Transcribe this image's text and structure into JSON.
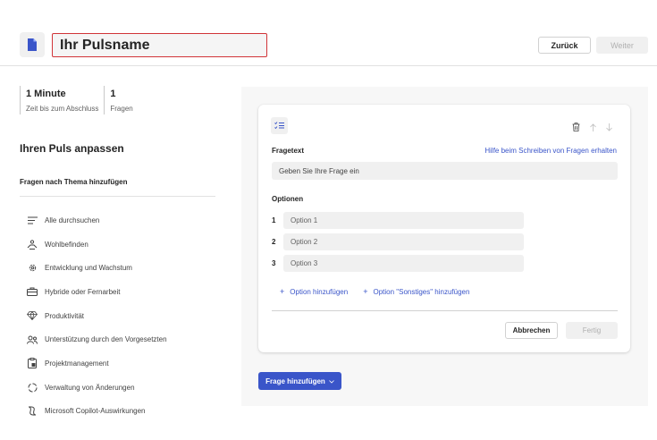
{
  "header": {
    "title_value": "Ihr Pulsname",
    "back_label": "Zurück",
    "next_label": "Weiter",
    "doc_icon": "document-icon"
  },
  "stats": [
    {
      "value": "1 Minute",
      "label": "Zeit bis zum Abschluss"
    },
    {
      "value": "1",
      "label": "Fragen"
    }
  ],
  "sidebar": {
    "customize_title": "Ihren Puls anpassen",
    "topic_title": "Fragen nach Thema hinzufügen",
    "topics": [
      {
        "label": "Alle durchsuchen",
        "icon": "list-icon"
      },
      {
        "label": "Wohlbefinden",
        "icon": "relax-icon"
      },
      {
        "label": "Entwicklung und Wachstum",
        "icon": "gear-icon"
      },
      {
        "label": "Hybride oder Fernarbeit",
        "icon": "briefcase-icon"
      },
      {
        "label": "Produktivität",
        "icon": "diamond-icon"
      },
      {
        "label": "Unterstützung durch den Vorgesetzten",
        "icon": "people-icon"
      },
      {
        "label": "Projektmanagement",
        "icon": "clipboard-icon"
      },
      {
        "label": "Verwaltung von Änderungen",
        "icon": "cycle-icon"
      },
      {
        "label": "Microsoft Copilot-Auswirkungen",
        "icon": "copilot-icon"
      }
    ]
  },
  "question_card": {
    "type_icon": "checklist-icon",
    "fragetext_label": "Fragetext",
    "help_link": "Hilfe beim Schreiben von Fragen erhalten",
    "question_placeholder": "Geben Sie Ihre Frage ein",
    "optionen_label": "Optionen",
    "options": [
      {
        "num": "1",
        "value": "Option 1"
      },
      {
        "num": "2",
        "value": "Option 2"
      },
      {
        "num": "3",
        "value": "Option 3"
      }
    ],
    "add_option": "Option hinzufügen",
    "add_other_option": "Option \"Sonstiges\" hinzufügen",
    "cancel_label": "Abbrechen",
    "done_label": "Fertig"
  },
  "add_question_label": "Frage hinzufügen",
  "colors": {
    "accent": "#3a55c9",
    "error_border": "#d13438"
  }
}
